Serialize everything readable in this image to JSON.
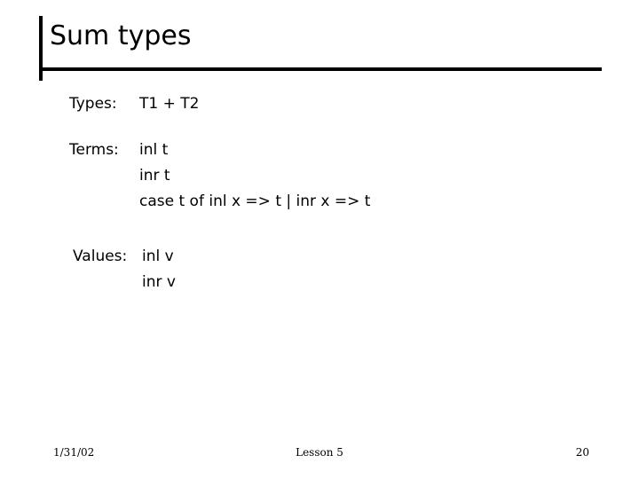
{
  "slide": {
    "title": "Sum types",
    "accent_color": "#000000",
    "background_color": "#ffffff",
    "text_color": "#000000"
  },
  "body": {
    "rows": [
      {
        "label": "Types:",
        "value": "T1 + T2"
      },
      {
        "label": "Terms:",
        "value": "inl t"
      },
      {
        "label": "Values:",
        "value": "inl v"
      }
    ],
    "terms_continuation": [
      "inr t",
      "case t of inl x => t | inr x => t"
    ],
    "values_continuation": [
      "inr v"
    ]
  },
  "footer": {
    "date": "1/31/02",
    "center": "Lesson 5",
    "page_number": "20"
  }
}
